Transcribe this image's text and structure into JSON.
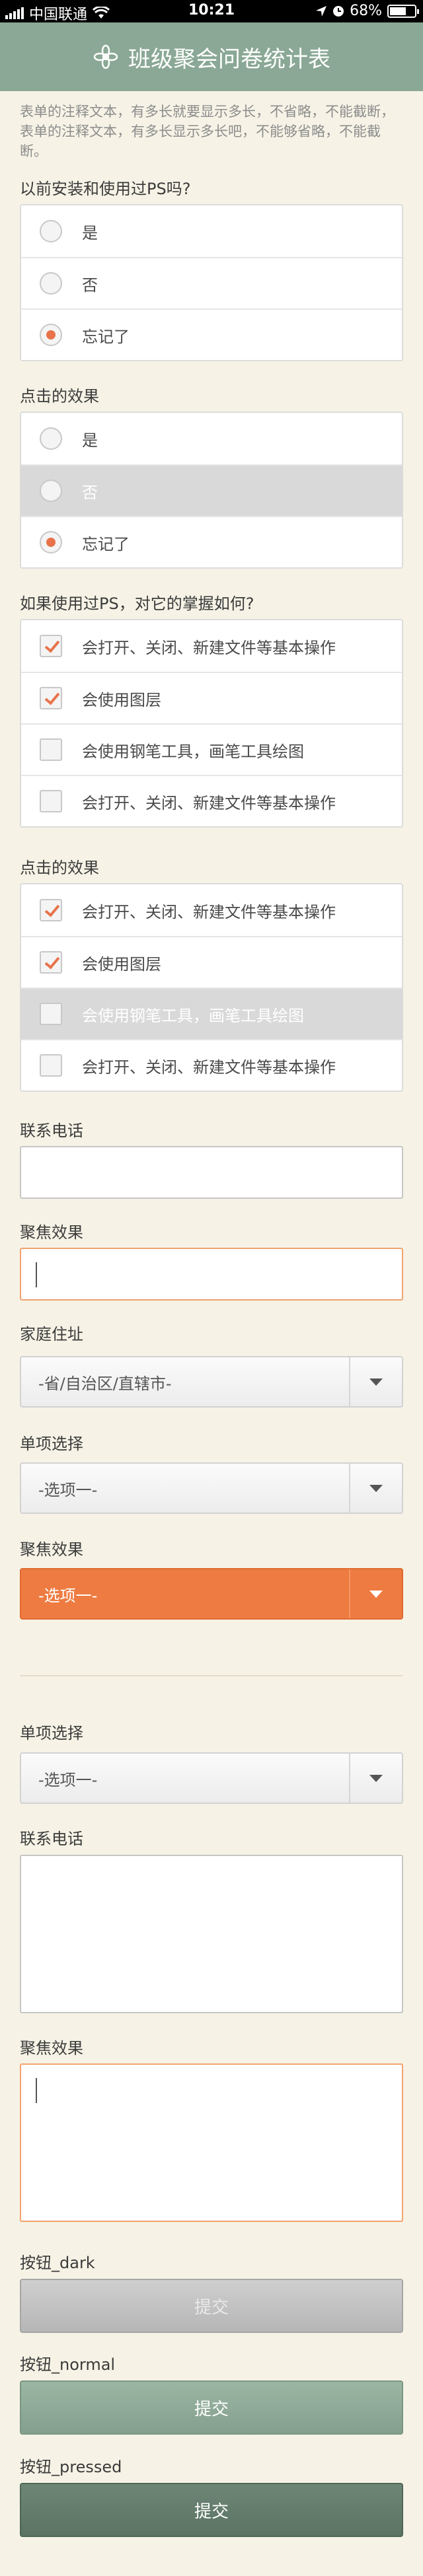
{
  "status": {
    "carrier": "中国联通",
    "time": "10:21",
    "battery": "68%",
    "battery_level": 0.68
  },
  "header": {
    "title": "班级聚会问卷统计表",
    "icon": "flower-icon"
  },
  "note": "表单的注释文本，有多长就要显示多长，不省略，不能截断，表单的注释文本，有多长显示多长吧，不能够省略，不能截断。",
  "q1": {
    "label": "以前安装和使用过PS吗?",
    "options": [
      "是",
      "否",
      "忘记了"
    ]
  },
  "q2": {
    "label": "点击的效果",
    "options": [
      "是",
      "否",
      "忘记了"
    ]
  },
  "q3": {
    "label": "如果使用过PS，对它的掌握如何?",
    "options": [
      "会打开、关闭、新建文件等基本操作",
      "会使用图层",
      "会使用钢笔工具，画笔工具绘图",
      "会打开、关闭、新建文件等基本操作"
    ]
  },
  "q4": {
    "label": "点击的效果",
    "options": [
      "会打开、关闭、新建文件等基本操作",
      "会使用图层",
      "会使用钢笔工具，画笔工具绘图",
      "会打开、关闭、新建文件等基本操作"
    ]
  },
  "phone": {
    "label": "联系电话"
  },
  "focus1": {
    "label": "聚焦效果"
  },
  "address": {
    "label": "家庭住址",
    "value": "-省/自治区/直辖市-"
  },
  "single1": {
    "label": "单项选择",
    "value": "-选项一-"
  },
  "focus2": {
    "label": "聚焦效果",
    "value": "-选项一-"
  },
  "single2": {
    "label": "单项选择",
    "value": "-选项一-"
  },
  "phone2": {
    "label": "联系电话"
  },
  "focus3": {
    "label": "聚焦效果"
  },
  "btn_dark": {
    "label": "按钮_dark",
    "text": "提交"
  },
  "btn_normal": {
    "label": "按钮_normal",
    "text": "提交"
  },
  "btn_pressed": {
    "label": "按钮_pressed",
    "text": "提交"
  },
  "colors": {
    "accent": "#ee7b41",
    "header": "#8aa895",
    "background": "#f6f3e6"
  }
}
